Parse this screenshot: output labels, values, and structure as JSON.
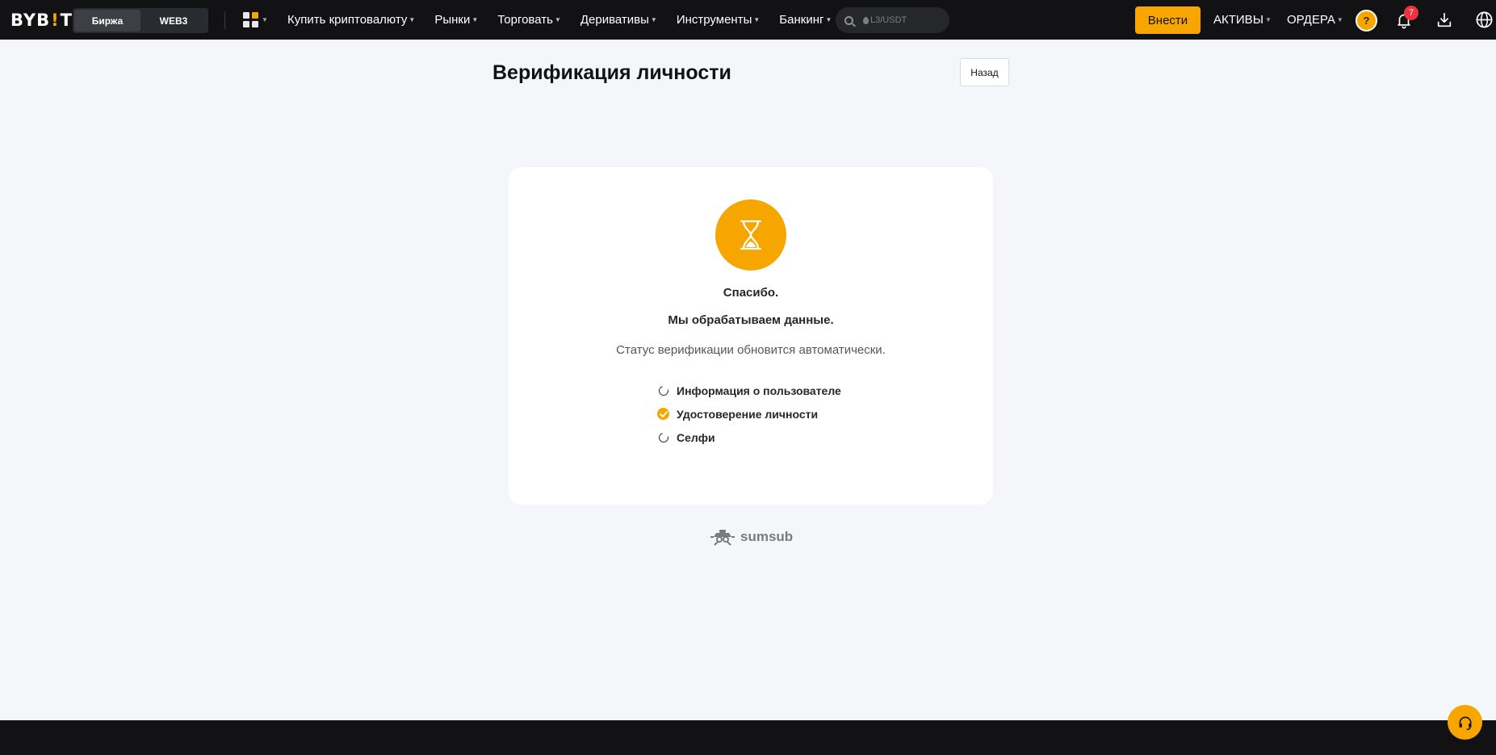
{
  "header": {
    "logo": {
      "left": "BYB",
      "mark": "!",
      "right": "T"
    },
    "switcher": {
      "exchange": "Биржа",
      "web3": "WEB3"
    },
    "apps_icon": "grid-apps-icon",
    "nav": [
      {
        "label": "Купить криптовалюту"
      },
      {
        "label": "Рынки"
      },
      {
        "label": "Торговать"
      },
      {
        "label": "Деривативы"
      },
      {
        "label": "Инструменты"
      },
      {
        "label": "Банкинг"
      }
    ],
    "search": {
      "placeholder": "L3/USDT"
    },
    "deposit_label": "Внести",
    "assets_label": "АКТИВЫ",
    "orders_label": "ОРДЕРА",
    "avatar_text": "?",
    "notifications_count": "7"
  },
  "page": {
    "title": "Верификация личности",
    "back_label": "Назад"
  },
  "status_card": {
    "icon": "hourglass-icon",
    "thanks": "Спасибо.",
    "processing": "Мы обрабатываем данные.",
    "note": "Статус верификации обновится автоматически.",
    "steps": [
      {
        "label": "Информация о пользователе",
        "state": "pending"
      },
      {
        "label": "Удостоверение личности",
        "state": "done"
      },
      {
        "label": "Селфи",
        "state": "pending"
      }
    ]
  },
  "provider": {
    "name": "sumsub"
  },
  "colors": {
    "accent": "#f7a600",
    "topbar": "#121214",
    "background": "#f5f6f9",
    "badge": "#f0313f"
  }
}
